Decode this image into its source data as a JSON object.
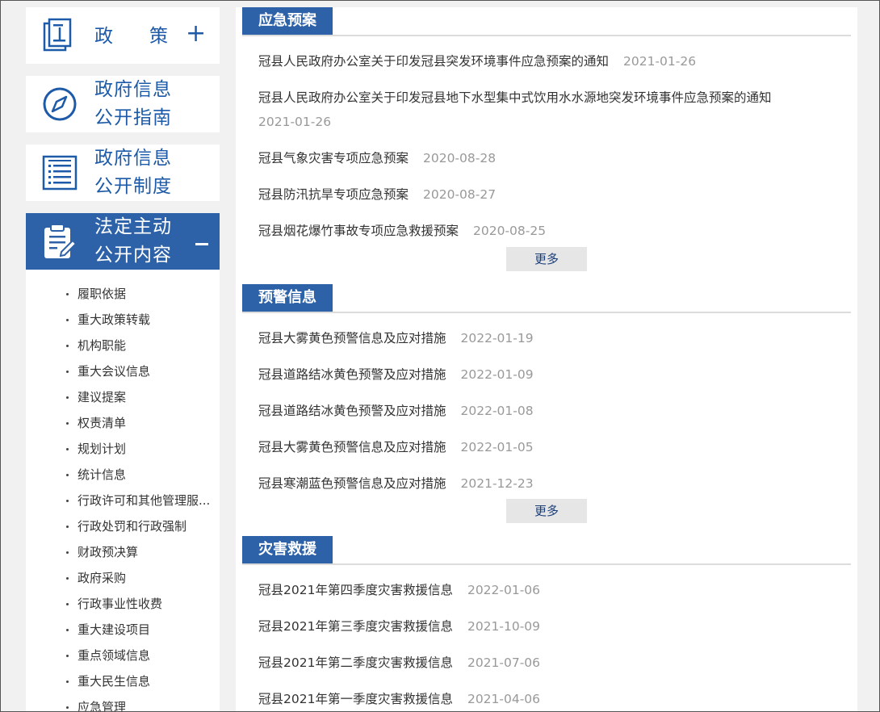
{
  "sidebar": {
    "policy": {
      "label_a": "政",
      "label_b": "策"
    },
    "guide": {
      "line1": "政府信息",
      "line2": "公开指南"
    },
    "system": {
      "line1": "政府信息",
      "line2": "公开制度"
    },
    "content": {
      "line1": "法定主动",
      "line2": "公开内容"
    },
    "items": [
      "履职依据",
      "重大政策转载",
      "机构职能",
      "重大会议信息",
      "建议提案",
      "权责清单",
      "规划计划",
      "统计信息",
      "行政许可和其他管理服...",
      "行政处罚和行政强制",
      "财政预决算",
      "政府采购",
      "行政事业性收费",
      "重大建设项目",
      "重点领域信息",
      "重大民生信息",
      "应急管理"
    ]
  },
  "sections": {
    "emergency_plan": {
      "title": "应急预案",
      "more": "更多",
      "items": [
        {
          "title": "冠县人民政府办公室关于印发冠县突发环境事件应急预案的通知",
          "date": "2021-01-26"
        },
        {
          "title": "冠县人民政府办公室关于印发冠县地下水型集中式饮用水水源地突发环境事件应急预案的通知",
          "date": "2021-01-26"
        },
        {
          "title": "冠县气象灾害专项应急预案",
          "date": "2020-08-28"
        },
        {
          "title": "冠县防汛抗旱专项应急预案",
          "date": "2020-08-27"
        },
        {
          "title": "冠县烟花爆竹事故专项应急救援预案",
          "date": "2020-08-25"
        }
      ]
    },
    "warning": {
      "title": "预警信息",
      "more": "更多",
      "items": [
        {
          "title": "冠县大雾黄色预警信息及应对措施",
          "date": "2022-01-19"
        },
        {
          "title": "冠县道路结冰黄色预警及应对措施",
          "date": "2022-01-09"
        },
        {
          "title": "冠县道路结冰黄色预警及应对措施",
          "date": "2022-01-08"
        },
        {
          "title": "冠县大雾黄色预警信息及应对措施",
          "date": "2022-01-05"
        },
        {
          "title": "冠县寒潮蓝色预警信息及应对措施",
          "date": "2021-12-23"
        }
      ]
    },
    "relief": {
      "title": "灾害救援",
      "items": [
        {
          "title": "冠县2021年第四季度灾害救援信息",
          "date": "2022-01-06"
        },
        {
          "title": "冠县2021年第三季度灾害救援信息",
          "date": "2021-10-09"
        },
        {
          "title": "冠县2021年第二季度灾害救援信息",
          "date": "2021-07-06"
        },
        {
          "title": "冠县2021年第一季度灾害救援信息",
          "date": "2021-04-06"
        }
      ]
    }
  },
  "colors": {
    "accent": "#2d62a9",
    "date": "#999999",
    "more_bg": "#e6e6e6"
  }
}
